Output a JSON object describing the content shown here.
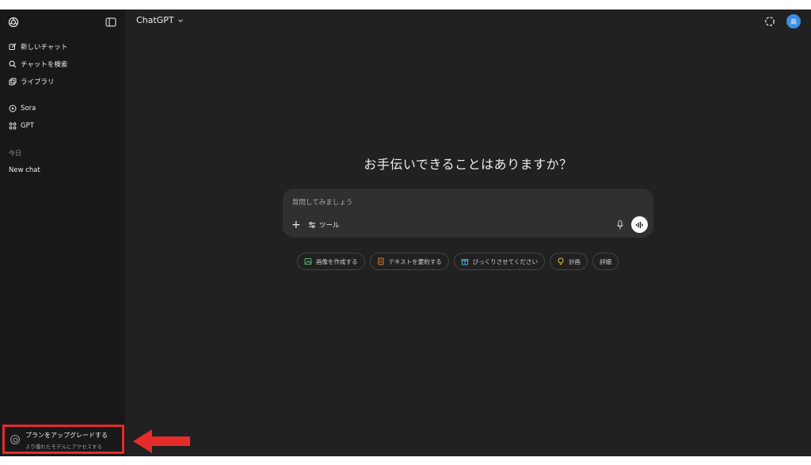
{
  "app": {
    "model_name": "ChatGPT",
    "avatar_initial": "高"
  },
  "sidebar": {
    "items": [
      {
        "label": "新しいチャット",
        "icon": "edit-icon"
      },
      {
        "label": "チャットを検索",
        "icon": "search-icon"
      },
      {
        "label": "ライブラリ",
        "icon": "library-icon"
      },
      {
        "label": "Sora",
        "icon": "play-circle-icon"
      },
      {
        "label": "GPT",
        "icon": "grid-icon"
      }
    ],
    "section_today": "今日",
    "chats": [
      "New chat"
    ],
    "upgrade": {
      "title": "プランをアップグレードする",
      "subtitle": "より優れたモデルにアクセスする"
    }
  },
  "main": {
    "headline": "お手伝いできることはありますか？",
    "composer": {
      "placeholder": "質問してみましょう",
      "tools_label": "ツール"
    },
    "suggestions": [
      {
        "label": "画像を作成する",
        "icon": "image-icon",
        "color": "#4fb36a"
      },
      {
        "label": "テキストを要約する",
        "icon": "document-icon",
        "color": "#e0823b"
      },
      {
        "label": "びっくりさせてください",
        "icon": "gift-icon",
        "color": "#5aa9d6"
      },
      {
        "label": "計画",
        "icon": "lightbulb-icon",
        "color": "#e2c23c"
      },
      {
        "label": "詳細",
        "icon": "",
        "color": ""
      }
    ]
  },
  "colors": {
    "background": "#212121",
    "sidebar": "#181818",
    "composer": "#303030",
    "highlight": "#e52b2b",
    "avatar": "#3b8ee8"
  }
}
